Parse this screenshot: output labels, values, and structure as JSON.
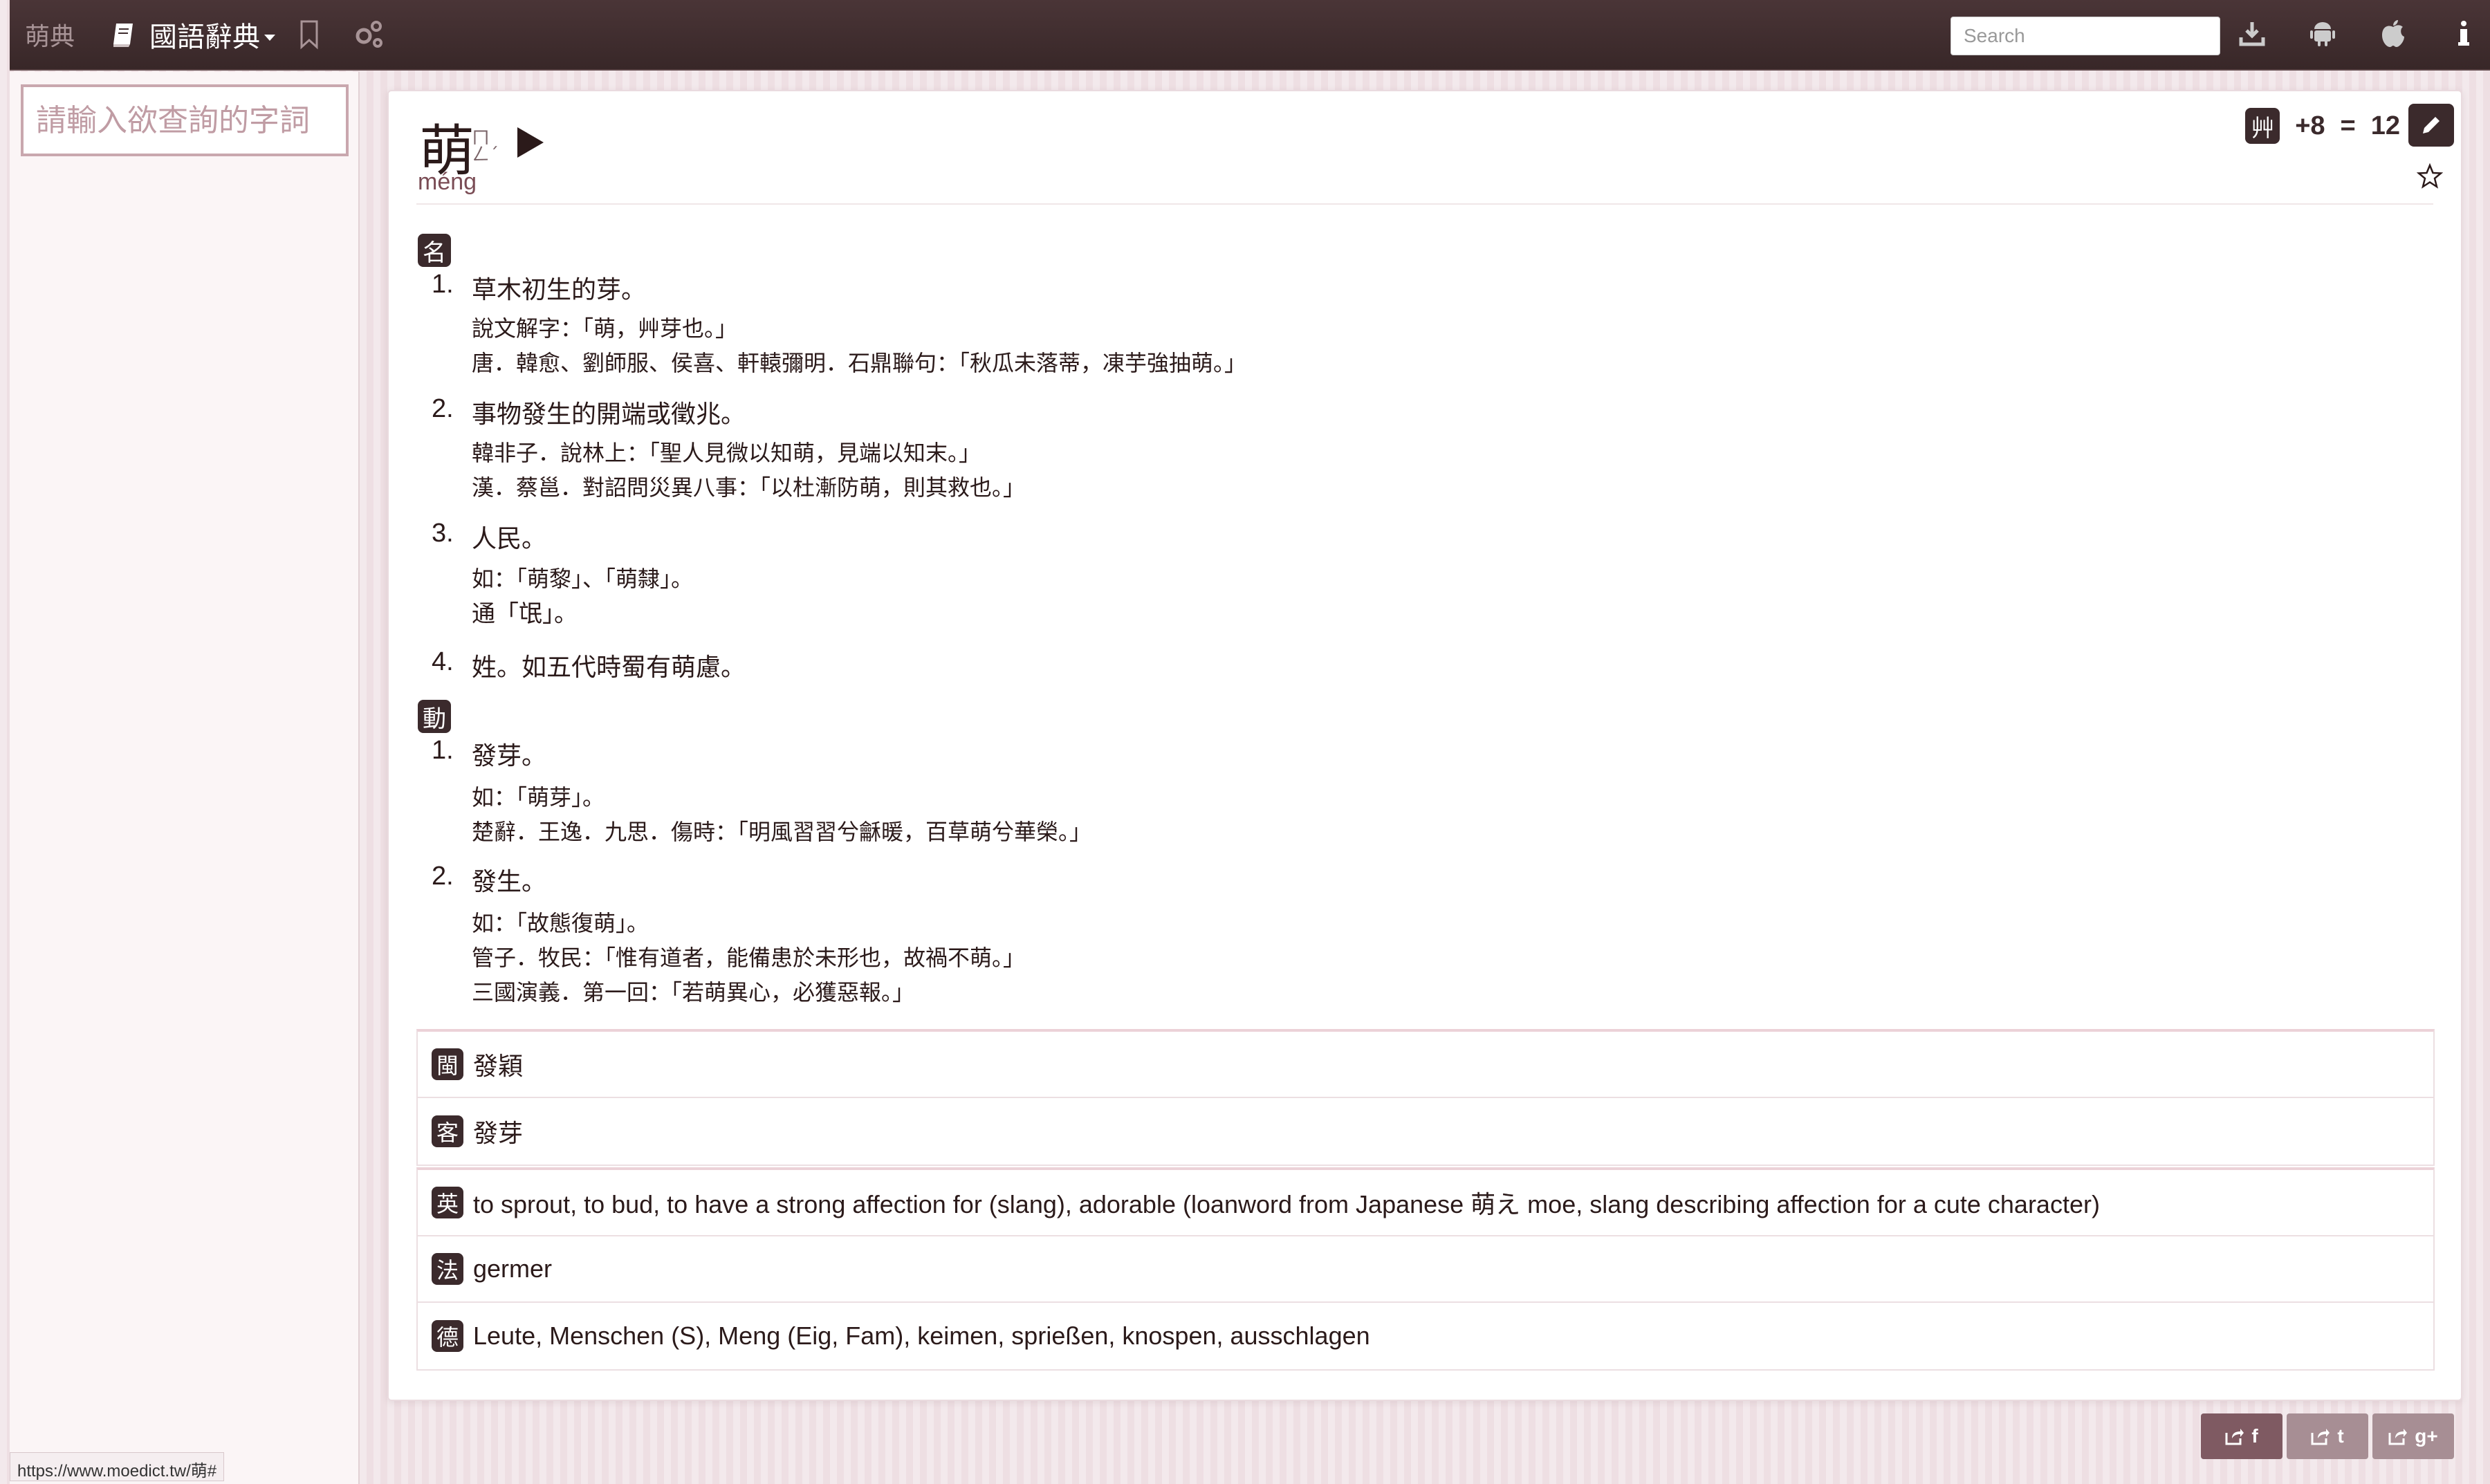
{
  "app": {
    "brand": "萌典",
    "dict_label": "國語辭典"
  },
  "search": {
    "placeholder": "Search"
  },
  "sidebar": {
    "query_placeholder": "請輸入欲查詢的字詞"
  },
  "entry": {
    "character": "萌",
    "bopomofo": [
      "ㄇ",
      "ㄥ",
      "ˊ"
    ],
    "pinyin": "méng",
    "radical": {
      "badge": "艸",
      "strokes": "+8",
      "equals": "=",
      "total": "12"
    }
  },
  "sections": [
    {
      "pos": "名",
      "definitions": [
        {
          "num": "1.",
          "text": "草木初生的芽。",
          "examples": [
            "說文解字：「萌，艸芽也。」",
            "唐．韓愈、劉師服、侯喜、軒轅彌明．石鼎聯句：「秋瓜未落蒂，凍芋強抽萌。」"
          ]
        },
        {
          "num": "2.",
          "text": "事物發生的開端或徵兆。",
          "examples": [
            "韓非子．說林上：「聖人見微以知萌，見端以知末。」",
            "漢．蔡邕．對詔問災異八事：「以杜漸防萌，則其救也。」"
          ]
        },
        {
          "num": "3.",
          "text": "人民。",
          "examples": [
            "如：「萌黎」、「萌隸」。"
          ],
          "note": "通「氓」。"
        },
        {
          "num": "4.",
          "text": "姓。如五代時蜀有萌慮。",
          "examples": []
        }
      ]
    },
    {
      "pos": "動",
      "definitions": [
        {
          "num": "1.",
          "text": "發芽。",
          "examples": [
            "如：「萌芽」。",
            "楚辭．王逸．九思．傷時：「明風習習兮龢暖，百草萌兮華榮。」"
          ]
        },
        {
          "num": "2.",
          "text": "發生。",
          "examples": [
            "如：「故態復萌」。",
            "管子．牧民：「惟有道者，能備患於未形也，故禍不萌。」",
            "三國演義．第一回：「若萌異心，必獲惡報。」"
          ]
        }
      ]
    }
  ],
  "dialects": [
    {
      "badge": "閩",
      "text": "發穎"
    },
    {
      "badge": "客",
      "text": "發芽"
    }
  ],
  "translations": [
    {
      "badge": "英",
      "text": "to sprout, to bud, to have a strong affection for (slang), adorable (loanword from Japanese 萌え moe, slang describing affection for a cute character)"
    },
    {
      "badge": "法",
      "text": "germer"
    },
    {
      "badge": "德",
      "text": "Leute, Menschen (S), Meng (Eig, Fam), keimen, sprießen, knospen, ausschlagen"
    }
  ],
  "status_url": "https://www.moedict.tw/萌#",
  "share": [
    {
      "name": "facebook",
      "label": "f"
    },
    {
      "name": "twitter",
      "label": "t"
    },
    {
      "name": "google-plus",
      "label": "g+"
    }
  ],
  "colors": {
    "topbar": "#3e2c2e",
    "accent": "#3b2a2c",
    "share": "#7f5a62"
  }
}
